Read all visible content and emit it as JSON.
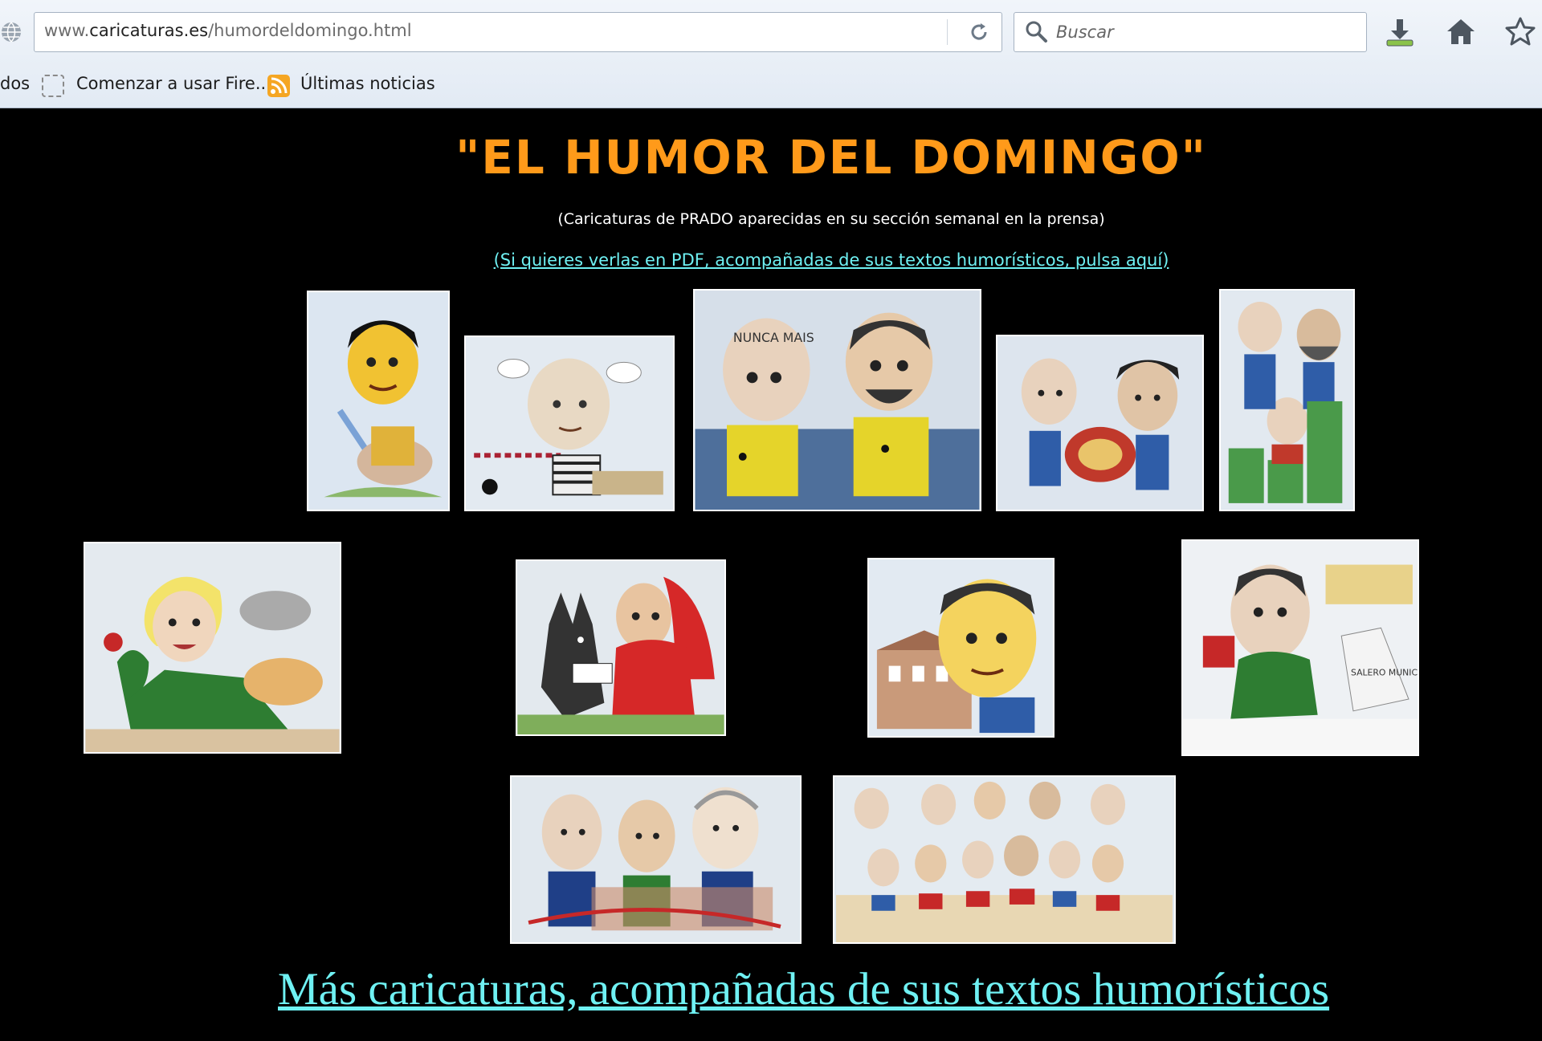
{
  "browser": {
    "url_prefix": "www.",
    "url_domain": "caricaturas.es",
    "url_path": "/humordeldomingo.html",
    "search_placeholder": "Buscar",
    "bookmarks": [
      {
        "label": "dos"
      },
      {
        "label": "Comenzar a usar Fire..."
      },
      {
        "label": "Últimas noticias"
      }
    ]
  },
  "page": {
    "title": "\"EL HUMOR DEL DOMINGO\"",
    "subtitle": "(Caricaturas de PRADO aparecidas en su sección semanal en la prensa)",
    "pdf_link": "(Si quieres verlas en PDF,  acompañadas de sus textos humorísticos, pulsa aquí)",
    "more_link": "Más caricaturas, acompañadas de sus textos humorísticos"
  },
  "thumbnails": [
    {
      "name": "caricature-man-knight-horse",
      "bg": "#dfe8f2"
    },
    {
      "name": "caricature-bald-man-prisoner",
      "bg": "#e2e9f0"
    },
    {
      "name": "caricature-two-men-nunca-mais",
      "bg": "#d4dde8"
    },
    {
      "name": "caricature-two-men-music",
      "bg": "#dfe6ef"
    },
    {
      "name": "caricature-three-men-podium",
      "bg": "#e0e8f0"
    },
    {
      "name": "caricature-blonde-woman-rose",
      "bg": "#e6ebef"
    },
    {
      "name": "caricature-wolf-red-riding-hood",
      "bg": "#e3e9ee"
    },
    {
      "name": "caricature-man-building",
      "bg": "#e2eaf2"
    },
    {
      "name": "caricature-man-snow-salero",
      "bg": "#eef1f4"
    },
    {
      "name": "caricature-three-men-ribbon",
      "bg": "#e1e8ee"
    },
    {
      "name": "caricature-group-beach",
      "bg": "#e4ebf1"
    }
  ],
  "thumbnail_labels": {
    "nunca_mais": "NUNCA MAIS",
    "salero": "SALERO MUNICIPAL"
  },
  "colors": {
    "title": "#ff9a1a",
    "link": "#6ff1f3",
    "background": "#000000"
  }
}
